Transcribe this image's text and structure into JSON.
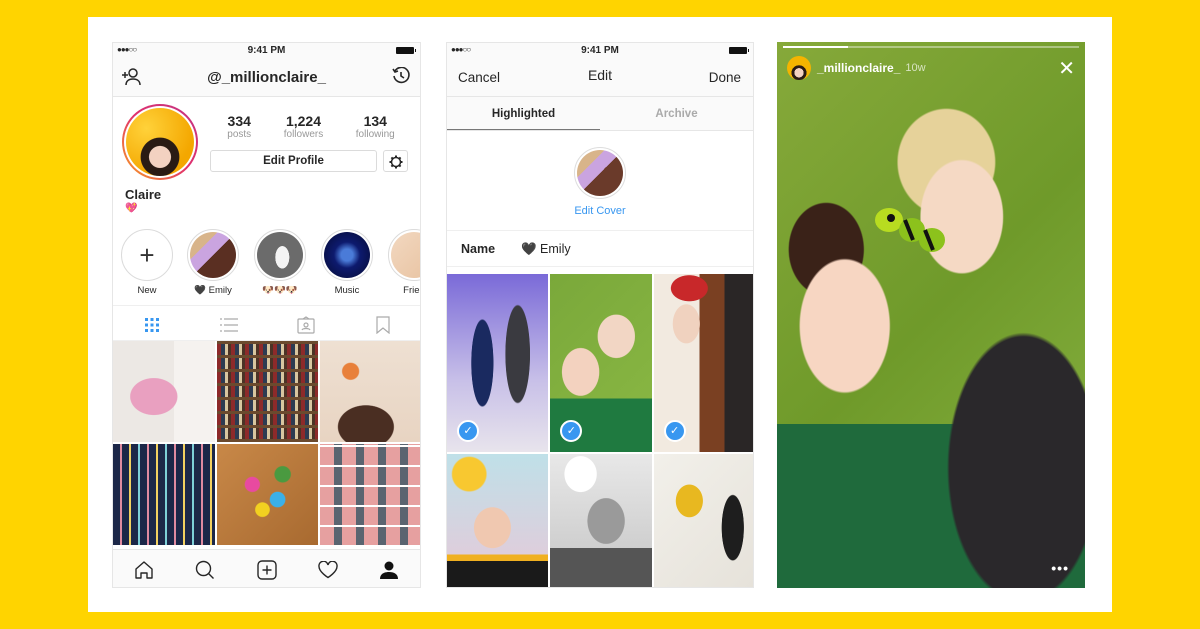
{
  "colors": {
    "background": "#FFD400",
    "accent": "#3897f0",
    "text": "#262626",
    "muted": "#999999"
  },
  "status_bar": {
    "signal": "●●●○○",
    "time": "9:41 PM"
  },
  "profile_screen": {
    "header": {
      "username": "@_millionclaire_",
      "add_person_icon": "add-person-icon",
      "archive_icon": "history-clock-icon"
    },
    "stats": [
      {
        "value": "334",
        "label": "posts"
      },
      {
        "value": "1,224",
        "label": "followers"
      },
      {
        "value": "134",
        "label": "following"
      }
    ],
    "edit_profile_label": "Edit Profile",
    "settings_icon": "gear-icon",
    "display_name": "Claire",
    "bio": "💖",
    "highlights": [
      {
        "label": "New",
        "icon": "plus-icon"
      },
      {
        "label": "🖤 Emily"
      },
      {
        "label": "🐶🐶🐶"
      },
      {
        "label": "Music"
      },
      {
        "label": "Frien"
      }
    ],
    "view_tabs": [
      {
        "name": "grid",
        "icon": "grid-icon",
        "active": true
      },
      {
        "name": "list",
        "icon": "list-icon",
        "active": false
      },
      {
        "name": "tagged",
        "icon": "tagged-icon",
        "active": false
      },
      {
        "name": "saved",
        "icon": "bookmark-icon",
        "active": false
      }
    ],
    "posts": [
      "pink beaded purse",
      "bookshelf with stool",
      "mermaid figurines selfie",
      "striped wall with sneakers",
      "origami cranes",
      "pink building fire escape"
    ],
    "bottom_tabs": [
      {
        "name": "home",
        "icon": "home-icon"
      },
      {
        "name": "search",
        "icon": "search-icon"
      },
      {
        "name": "new-post",
        "icon": "plus-square-icon"
      },
      {
        "name": "activity",
        "icon": "heart-icon"
      },
      {
        "name": "profile",
        "icon": "person-icon",
        "active": true
      }
    ]
  },
  "edit_screen": {
    "cancel_label": "Cancel",
    "title": "Edit",
    "done_label": "Done",
    "segments": [
      {
        "label": "Highlighted",
        "active": true
      },
      {
        "label": "Archive",
        "active": false
      }
    ],
    "edit_cover_label": "Edit Cover",
    "name_label": "Name",
    "name_value": "🖤 Emily",
    "stories": [
      {
        "desc": "party neon arrow",
        "selected": true
      },
      {
        "desc": "friends with caterpillar sticker",
        "selected": true
      },
      {
        "desc": "red beanie mirror",
        "selected": true
      },
      {
        "desc": "sunglasses emoji face filter",
        "selected": false
      },
      {
        "desc": "cloud filter black and white",
        "selected": false
      },
      {
        "desc": "yellow sneakers",
        "selected": false
      }
    ],
    "check_glyph": "✓"
  },
  "story_screen": {
    "username": "_millionclaire_",
    "age": "10w",
    "progress": 0.22,
    "close_glyph": "✕",
    "more_glyph": "•••"
  }
}
